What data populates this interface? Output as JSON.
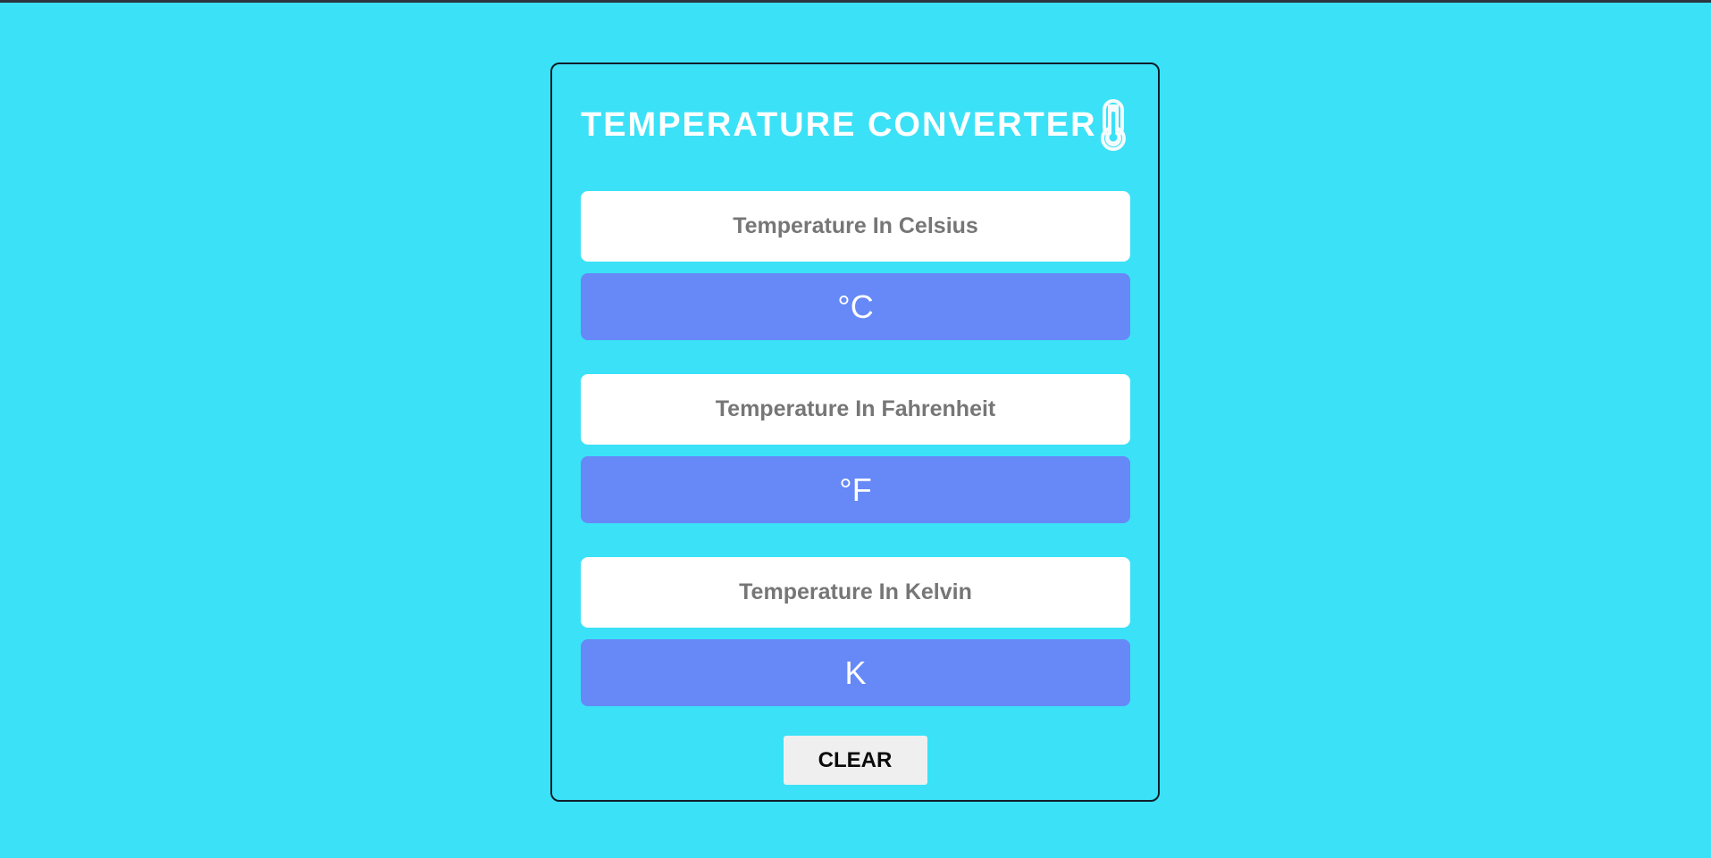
{
  "app": {
    "title": "TEMPERATURE CONVERTER",
    "icon": "thermometer-icon"
  },
  "fields": [
    {
      "placeholder": "Temperature In Celsius",
      "unit": "°C"
    },
    {
      "placeholder": "Temperature In Fahrenheit",
      "unit": "°F"
    },
    {
      "placeholder": "Temperature In Kelvin",
      "unit": "K"
    }
  ],
  "actions": {
    "clear_label": "CLEAR"
  },
  "colors": {
    "background": "#3be1f7",
    "unit_box": "#6689f7",
    "input": "#ffffff",
    "border": "#0f1f2a",
    "button": "#efefef"
  }
}
